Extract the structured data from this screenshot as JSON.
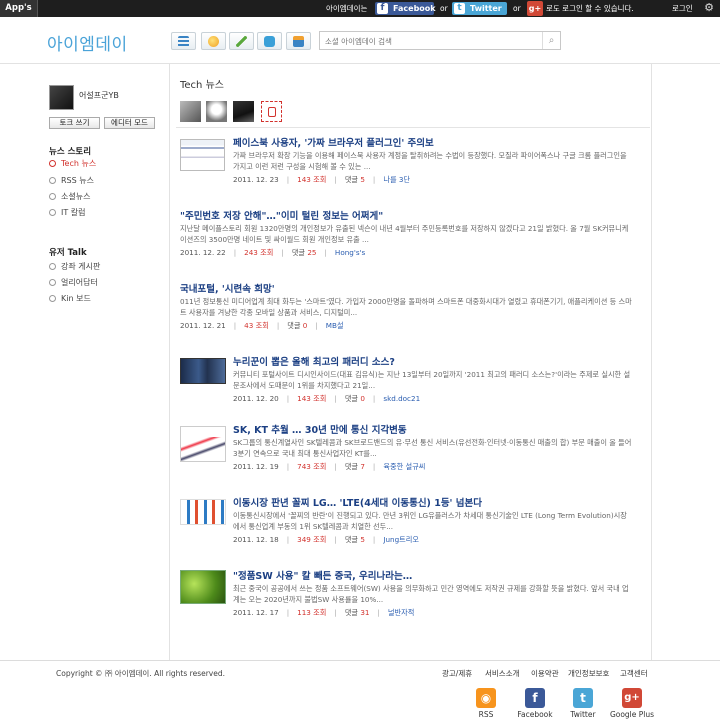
{
  "topbar": {
    "apps": "App's",
    "site_name": "아이엠데이는",
    "facebook": "Facebook",
    "or1": "or",
    "twitter": "Twitter",
    "or2": "or",
    "google_login": "로도 로그인 할 수 있습니다.",
    "login": "로그인"
  },
  "header": {
    "logo": "아이엠데이",
    "search_placeholder": "소셜 아이엠데이 검색"
  },
  "sidebar": {
    "username": "어설프군YB",
    "talk_button": "토크 쓰기",
    "editor_button": "에디터 모드",
    "news_heading": "뉴스 스토리",
    "news_items": [
      "Tech 뉴스",
      "RSS 뉴스",
      "소셜뉴스",
      "IT 칼럼"
    ],
    "talk_heading": "유저 Talk",
    "talk_items": [
      "강좌 게시판",
      "얼리어답터",
      "Kin 보드"
    ]
  },
  "main": {
    "title": "Tech 뉴스",
    "articles": [
      {
        "title": "페이스북 사용자, '가짜 브라우저 플러그인' 주의보",
        "summary": "가짜 브라우저 확장 기능을 이용해 페이스북 사용자 계정을 탈취하려는 수법이 등장했다. 모질라 파이어폭스나 구글 크롬 플러그인을 가지고 이런 저런 구성을 시험해 볼 수 있는 ...",
        "date": "2011. 12. 23",
        "views": "143 조회",
        "comments_label": "댓글",
        "comments": "5",
        "author": "나를 3단"
      },
      {
        "title": "\"주민번호 저장 안해\"…\"이미 털린 정보는 어쩌게\"",
        "summary": "지난달 메이플스토리 회원 1320만명의 개인정보가 유출된 넥슨이 내년 4월부터 주민등록번호를 저장하지 않겠다고 21일 밝혔다. 올 7월 SK커뮤니케이션즈의 3500만명 네이트 및 싸이월드 회원 개인정보 유출 ...",
        "date": "2011. 12. 22",
        "views": "243 조회",
        "comments_label": "댓글",
        "comments": "25",
        "author": "Hong's's"
      },
      {
        "title": "국내포털, '시련속 희망'",
        "summary": "011년 정보통신 미디어업계 최대 화두는 '스마트'였다. 가입자 2000만명을 돌파하며 스마트폰 대중화시대가 열렸고 휴대폰기기, 애플리케이션 등 스마트 사용자를 겨냥한 각종 모바일 상품과 서비스, 디지털미...",
        "date": "2011. 12. 21",
        "views": "43 조회",
        "comments_label": "댓글",
        "comments": "0",
        "author": "MB설"
      },
      {
        "title": "누리꾼이 뽑은 올해 최고의 패러디 소스?",
        "summary": "커뮤니티 포털사이트 디시인사이드(대표 김유식)는 지난 13일부터 20일까지 '2011 최고의 패러디 소스는?'이라는 주제로 실시한 설문조사에서 도때문이 1위를 차지했다고 21일...",
        "date": "2011. 12. 20",
        "views": "143 조회",
        "comments_label": "댓글",
        "comments": "0",
        "author": "skd.doc21"
      },
      {
        "title": "SK, KT 추월 … 30년 만에 통신 지각변동",
        "summary": "SK그룹의 통신계열사인 SK텔레콤과 SK브로드밴드의 유·무선 통신 서비스(유선전화·인터넷·이동통신 매출의 합) 부문 매출이 올 들어 3분기 연속으로 국내 최대 통신사업자인 KT를...",
        "date": "2011. 12. 19",
        "views": "743 조회",
        "comments_label": "댓글",
        "comments": "7",
        "author": "육중한 설규씨"
      },
      {
        "title": "이동시장 판년 꼴찌 LG… 'LTE(4세대 이동통신) 1등' 넘본다",
        "summary": "이동통신시장에서 '꼴찌의 반란'이 진행되고 있다. 만년 3위인 LG유플러스가 차세대 통신기술인 LTE (Long Term Evolution)시장에서 통신업계 부동의 1위 SK텔레콤과 치열한 선두...",
        "date": "2011. 12. 18",
        "views": "349 조회",
        "comments_label": "댓글",
        "comments": "5",
        "author": "Jung트리오"
      },
      {
        "title": "\"정품SW 사용\" 칼 빼든 중국, 우리나라는…",
        "summary": "최근 중국이 공공에서 쓰는 정품 소프트웨어(SW) 사용을 의무화하고 민간 영역에도 저작권 규제를 강화할 뜻을 밝혔다. 앞서 국내 업계는 오는 2020년까지 불법SW 사용률을 10%...",
        "date": "2011. 12. 17",
        "views": "113 조회",
        "comments_label": "댓글",
        "comments": "31",
        "author": "널반자적"
      }
    ]
  },
  "footer": {
    "copyright": "Copyright © ㈜ 아이엠데이. All rights reserved.",
    "links": [
      "광고/제휴",
      "서비스소개",
      "이용약관",
      "개인정보보호",
      "고객센터"
    ],
    "social": [
      "RSS",
      "Facebook",
      "Twitter",
      "Google Plus"
    ]
  },
  "colors": {
    "accent": "#4aa3d8",
    "title_blue": "#1b3f83",
    "red": "#d2322d",
    "facebook": "#3b5998",
    "twitter": "#4aa6d6",
    "google": "#d14836",
    "rss": "#f7941d"
  }
}
